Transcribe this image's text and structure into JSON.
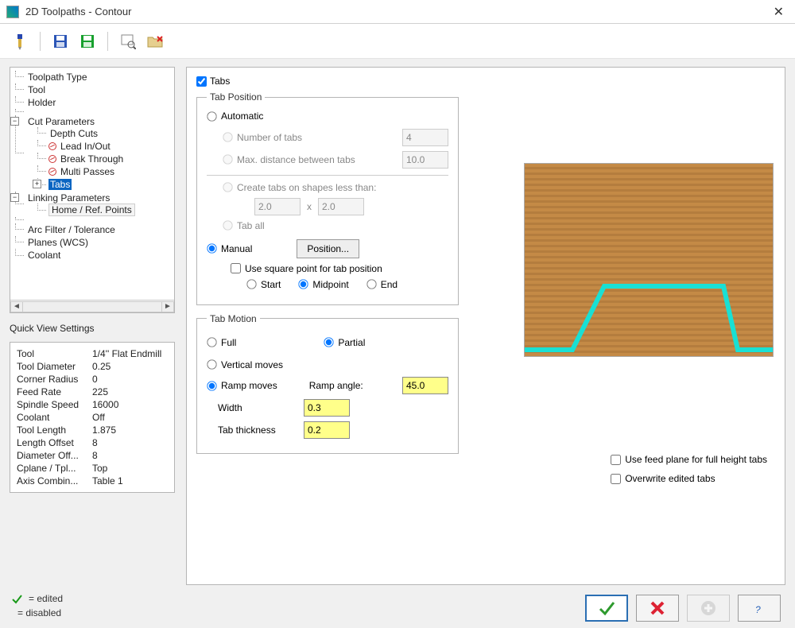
{
  "window": {
    "title": "2D Toolpaths - Contour"
  },
  "tree": {
    "items": [
      {
        "label": "Toolpath Type"
      },
      {
        "label": "Tool"
      },
      {
        "label": "Holder"
      },
      {
        "label": "Cut Parameters",
        "expandable": true,
        "expander": "−",
        "children": [
          {
            "label": "Depth Cuts"
          },
          {
            "label": "Lead In/Out",
            "disabled": true
          },
          {
            "label": "Break Through",
            "disabled": true
          },
          {
            "label": "Multi Passes",
            "disabled": true
          },
          {
            "label": "Tabs",
            "selected": true,
            "expandable": true,
            "expander": "+"
          }
        ]
      },
      {
        "label": "Linking Parameters",
        "expandable": true,
        "expander": "−",
        "children": [
          {
            "label": "Home / Ref. Points"
          }
        ]
      },
      {
        "label": "Arc Filter / Tolerance"
      },
      {
        "label": "Planes (WCS)"
      },
      {
        "label": "Coolant"
      }
    ]
  },
  "quickView": {
    "title": "Quick View Settings",
    "rows": [
      {
        "k": "Tool",
        "v": "1/4'' Flat Endmill"
      },
      {
        "k": "Tool Diameter",
        "v": "0.25"
      },
      {
        "k": "Corner Radius",
        "v": "0"
      },
      {
        "k": "Feed Rate",
        "v": "225"
      },
      {
        "k": "Spindle Speed",
        "v": "16000"
      },
      {
        "k": "Coolant",
        "v": "Off"
      },
      {
        "k": "Tool Length",
        "v": "1.875"
      },
      {
        "k": "Length Offset",
        "v": "8"
      },
      {
        "k": "Diameter Off...",
        "v": "8"
      },
      {
        "k": "Cplane / Tpl...",
        "v": "Top"
      },
      {
        "k": "Axis Combin...",
        "v": "Table 1"
      }
    ]
  },
  "legend": {
    "edited": "= edited",
    "disabled": "= disabled"
  },
  "tabs": {
    "checkbox_label": "Tabs",
    "tab_position": {
      "legend": "Tab Position",
      "automatic": "Automatic",
      "number_of_tabs": "Number of tabs",
      "number_of_tabs_val": "4",
      "max_distance": "Max. distance between tabs",
      "max_distance_val": "10.0",
      "create_on_shapes": "Create tabs on shapes less than:",
      "shape_w": "2.0",
      "shape_sep": "x",
      "shape_h": "2.0",
      "tab_all": "Tab all",
      "manual": "Manual",
      "position_btn": "Position...",
      "use_square": "Use square point for tab position",
      "start": "Start",
      "midpoint": "Midpoint",
      "end": "End"
    },
    "tab_motion": {
      "legend": "Tab Motion",
      "full": "Full",
      "partial": "Partial",
      "vertical": "Vertical moves",
      "ramp": "Ramp moves",
      "ramp_angle_lbl": "Ramp angle:",
      "ramp_angle_val": "45.0",
      "width_lbl": "Width",
      "width_val": "0.3",
      "thickness_lbl": "Tab thickness",
      "thickness_val": "0.2"
    },
    "right_checks": {
      "feed_plane": "Use feed plane for full height tabs",
      "overwrite": "Overwrite edited tabs"
    }
  }
}
